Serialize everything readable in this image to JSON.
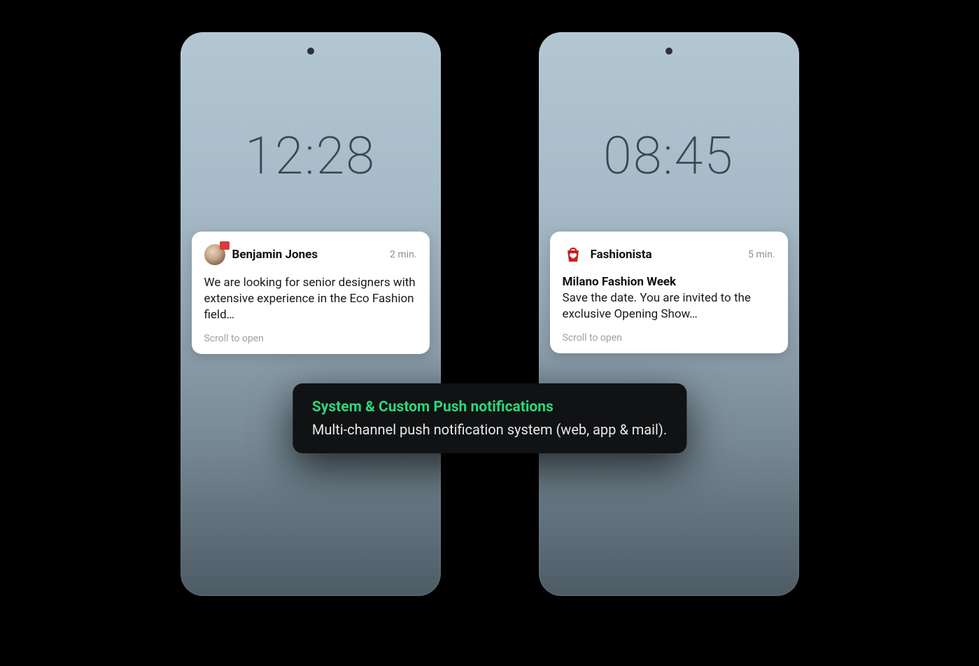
{
  "phones": [
    {
      "clock": "12:28",
      "notification": {
        "sender": "Benjamin Jones",
        "time": "2 min.",
        "body": "We are looking for senior designers with extensive experience in the Eco Fashion field…",
        "hint": "Scroll to open"
      }
    },
    {
      "clock": "08:45",
      "notification": {
        "sender": "Fashionista",
        "time": "5 min.",
        "title": "Milano Fashion Week",
        "body": "Save the date. You are invited to the exclusive Opening Show…",
        "hint": "Scroll to open"
      }
    }
  ],
  "caption": {
    "title": "System & Custom Push notifications",
    "body": "Multi-channel push notification system (web, app & mail)."
  },
  "colors": {
    "accent_green": "#28d97b",
    "brand_red": "#c52121"
  }
}
